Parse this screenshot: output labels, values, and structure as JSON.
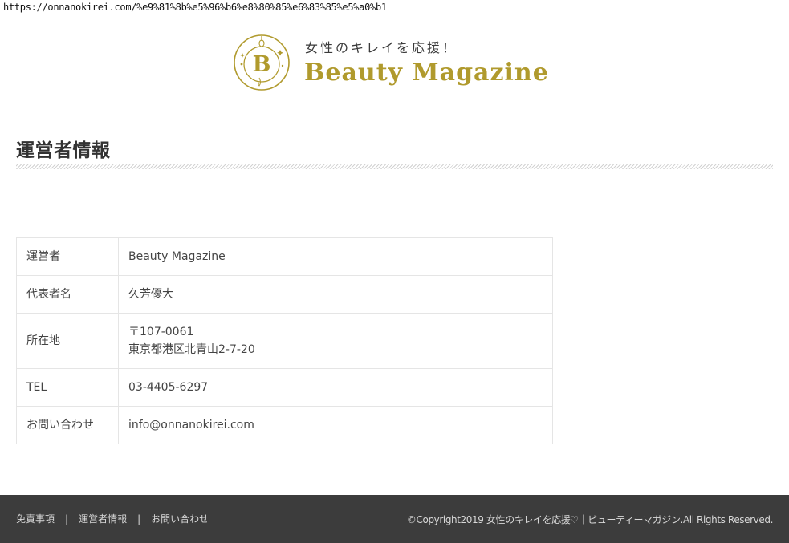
{
  "browser": {
    "url": "https://onnanokirei.com/%e9%81%8b%e5%96%b6%e8%80%85%e6%83%85%e5%a0%b1"
  },
  "header": {
    "tagline": "女性のキレイを応援！",
    "site_title": "Beauty Magazine",
    "emblem_letter": "B",
    "brand_color": "#b09a2d"
  },
  "page": {
    "title": "運営者情報"
  },
  "info_table": {
    "rows": [
      {
        "label": "運営者",
        "value": "Beauty Magazine"
      },
      {
        "label": "代表者名",
        "value": "久芳優大"
      },
      {
        "label": "所在地",
        "value_lines": [
          "〒107-0061",
          "東京都港区北青山2-7-20"
        ]
      },
      {
        "label": "TEL",
        "value": "03-4405-6297"
      },
      {
        "label": "お問い合わせ",
        "value": "info@onnanokirei.com"
      }
    ]
  },
  "footer": {
    "links": [
      "免責事項",
      "運営者情報",
      "お問い合わせ"
    ],
    "separator": "|",
    "copyright": "©Copyright2019 女性のキレイを応援♡｜ビューティーマガジン.All Rights Reserved.",
    "background_color": "#3c3c3c"
  }
}
